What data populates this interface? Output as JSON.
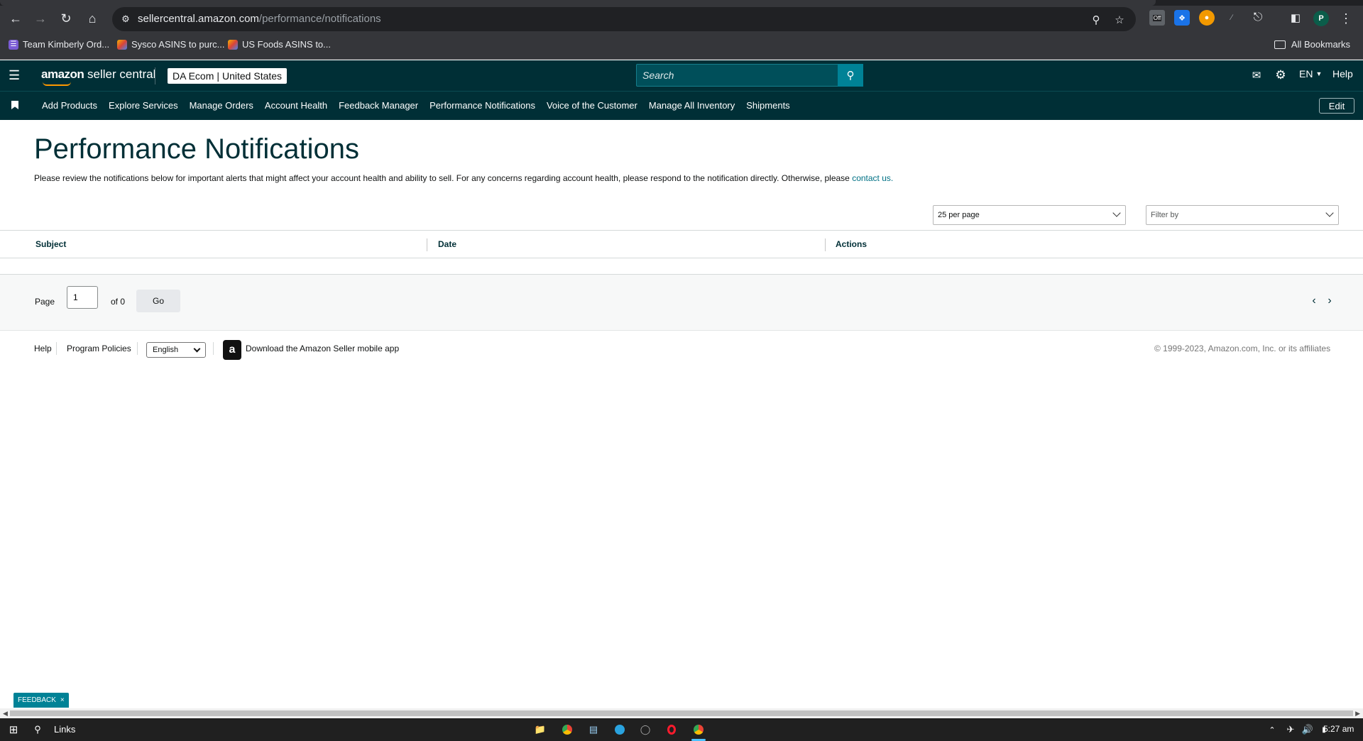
{
  "browser": {
    "url_host": "sellercentral.amazon.com",
    "url_path": "/performance/notifications",
    "bookmarks": [
      {
        "label": "Team Kimberly Ord..."
      },
      {
        "label": "Sysco ASINS to purc..."
      },
      {
        "label": "US Foods ASINS to..."
      }
    ],
    "all_bookmarks": "All Bookmarks",
    "profile_initial": "P",
    "ext_badge": "Off"
  },
  "header": {
    "logo_brand": "amazon",
    "logo_product": "seller central",
    "account_name": "DA Ecom",
    "account_region": "United States",
    "search_placeholder": "Search",
    "language": "EN",
    "help": "Help"
  },
  "nav": {
    "links": [
      "Add Products",
      "Explore Services",
      "Manage Orders",
      "Account Health",
      "Feedback Manager",
      "Performance Notifications",
      "Voice of the Customer",
      "Manage All Inventory",
      "Shipments"
    ],
    "edit": "Edit"
  },
  "page": {
    "title": "Performance Notifications",
    "description": "Please review the notifications below for important alerts that might affect your account health and ability to sell. For any concerns regarding account health, please respond to the notification directly. Otherwise, please",
    "contact_link": "contact us.",
    "per_page": "25 per page",
    "filter_placeholder": "Filter by"
  },
  "table": {
    "columns": [
      "Subject",
      "Date",
      "Actions"
    ],
    "rows": []
  },
  "pagination": {
    "page_label": "Page",
    "current_page": "1",
    "of_label": "of 0",
    "go": "Go",
    "prev": "‹",
    "next": "›"
  },
  "footer": {
    "help": "Help",
    "program_policies": "Program Policies",
    "language": "English",
    "app_link": "Download the Amazon Seller mobile app",
    "copyright": "© 1999-2023, Amazon.com, Inc. or its affiliates"
  },
  "feedback": {
    "label": "FEEDBACK",
    "close": "×"
  },
  "taskbar": {
    "search_label": "Links",
    "time": "5:27 am"
  }
}
